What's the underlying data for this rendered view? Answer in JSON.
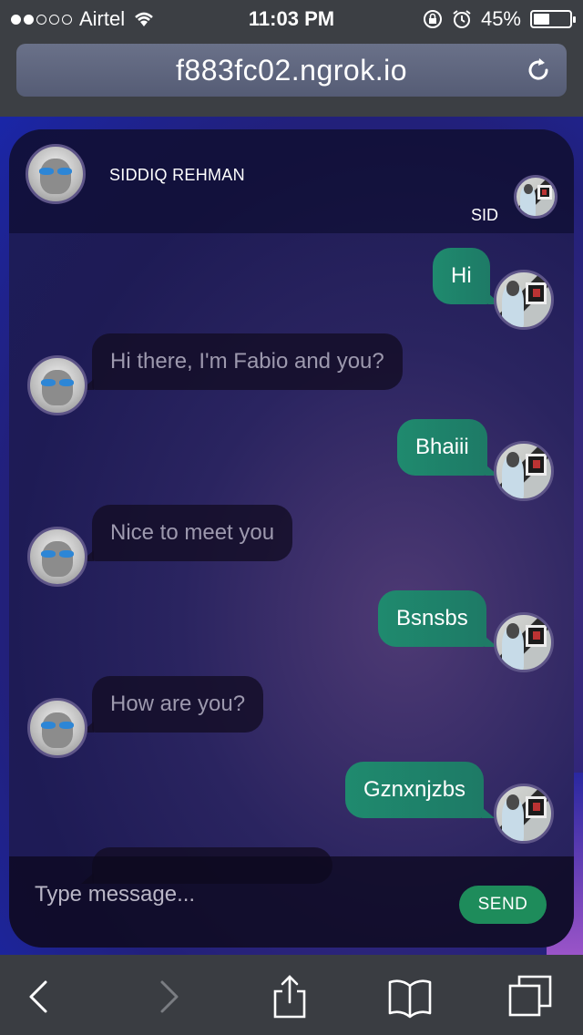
{
  "status_bar": {
    "carrier": "Airtel",
    "time": "11:03 PM",
    "battery": "45%",
    "battery_level": 0.45,
    "signal_bars": 2
  },
  "browser": {
    "url": "f883fc02.ngrok.io"
  },
  "chat": {
    "header": {
      "name": "SIDDIQ REHMAN",
      "user_label": "SID"
    },
    "messages": [
      {
        "side": "me",
        "text": "Hi"
      },
      {
        "side": "bot",
        "text": "Hi there, I'm Fabio and you?"
      },
      {
        "side": "me",
        "text": "Bhaiii"
      },
      {
        "side": "bot",
        "text": "Nice to meet you"
      },
      {
        "side": "me",
        "text": "Bsnsbs"
      },
      {
        "side": "bot",
        "text": "How are you?"
      },
      {
        "side": "me",
        "text": "Gznxnjzbs"
      }
    ],
    "composer": {
      "placeholder": "Type message...",
      "send_label": "SEND"
    }
  },
  "toolbar": {
    "icons": [
      "back-icon",
      "forward-icon",
      "share-icon",
      "bookmarks-icon",
      "tabs-icon"
    ]
  },
  "colors": {
    "sent_bubble": "#1f8a6e",
    "received_bubble": "#140e26",
    "send_button": "#1e8c5b"
  }
}
